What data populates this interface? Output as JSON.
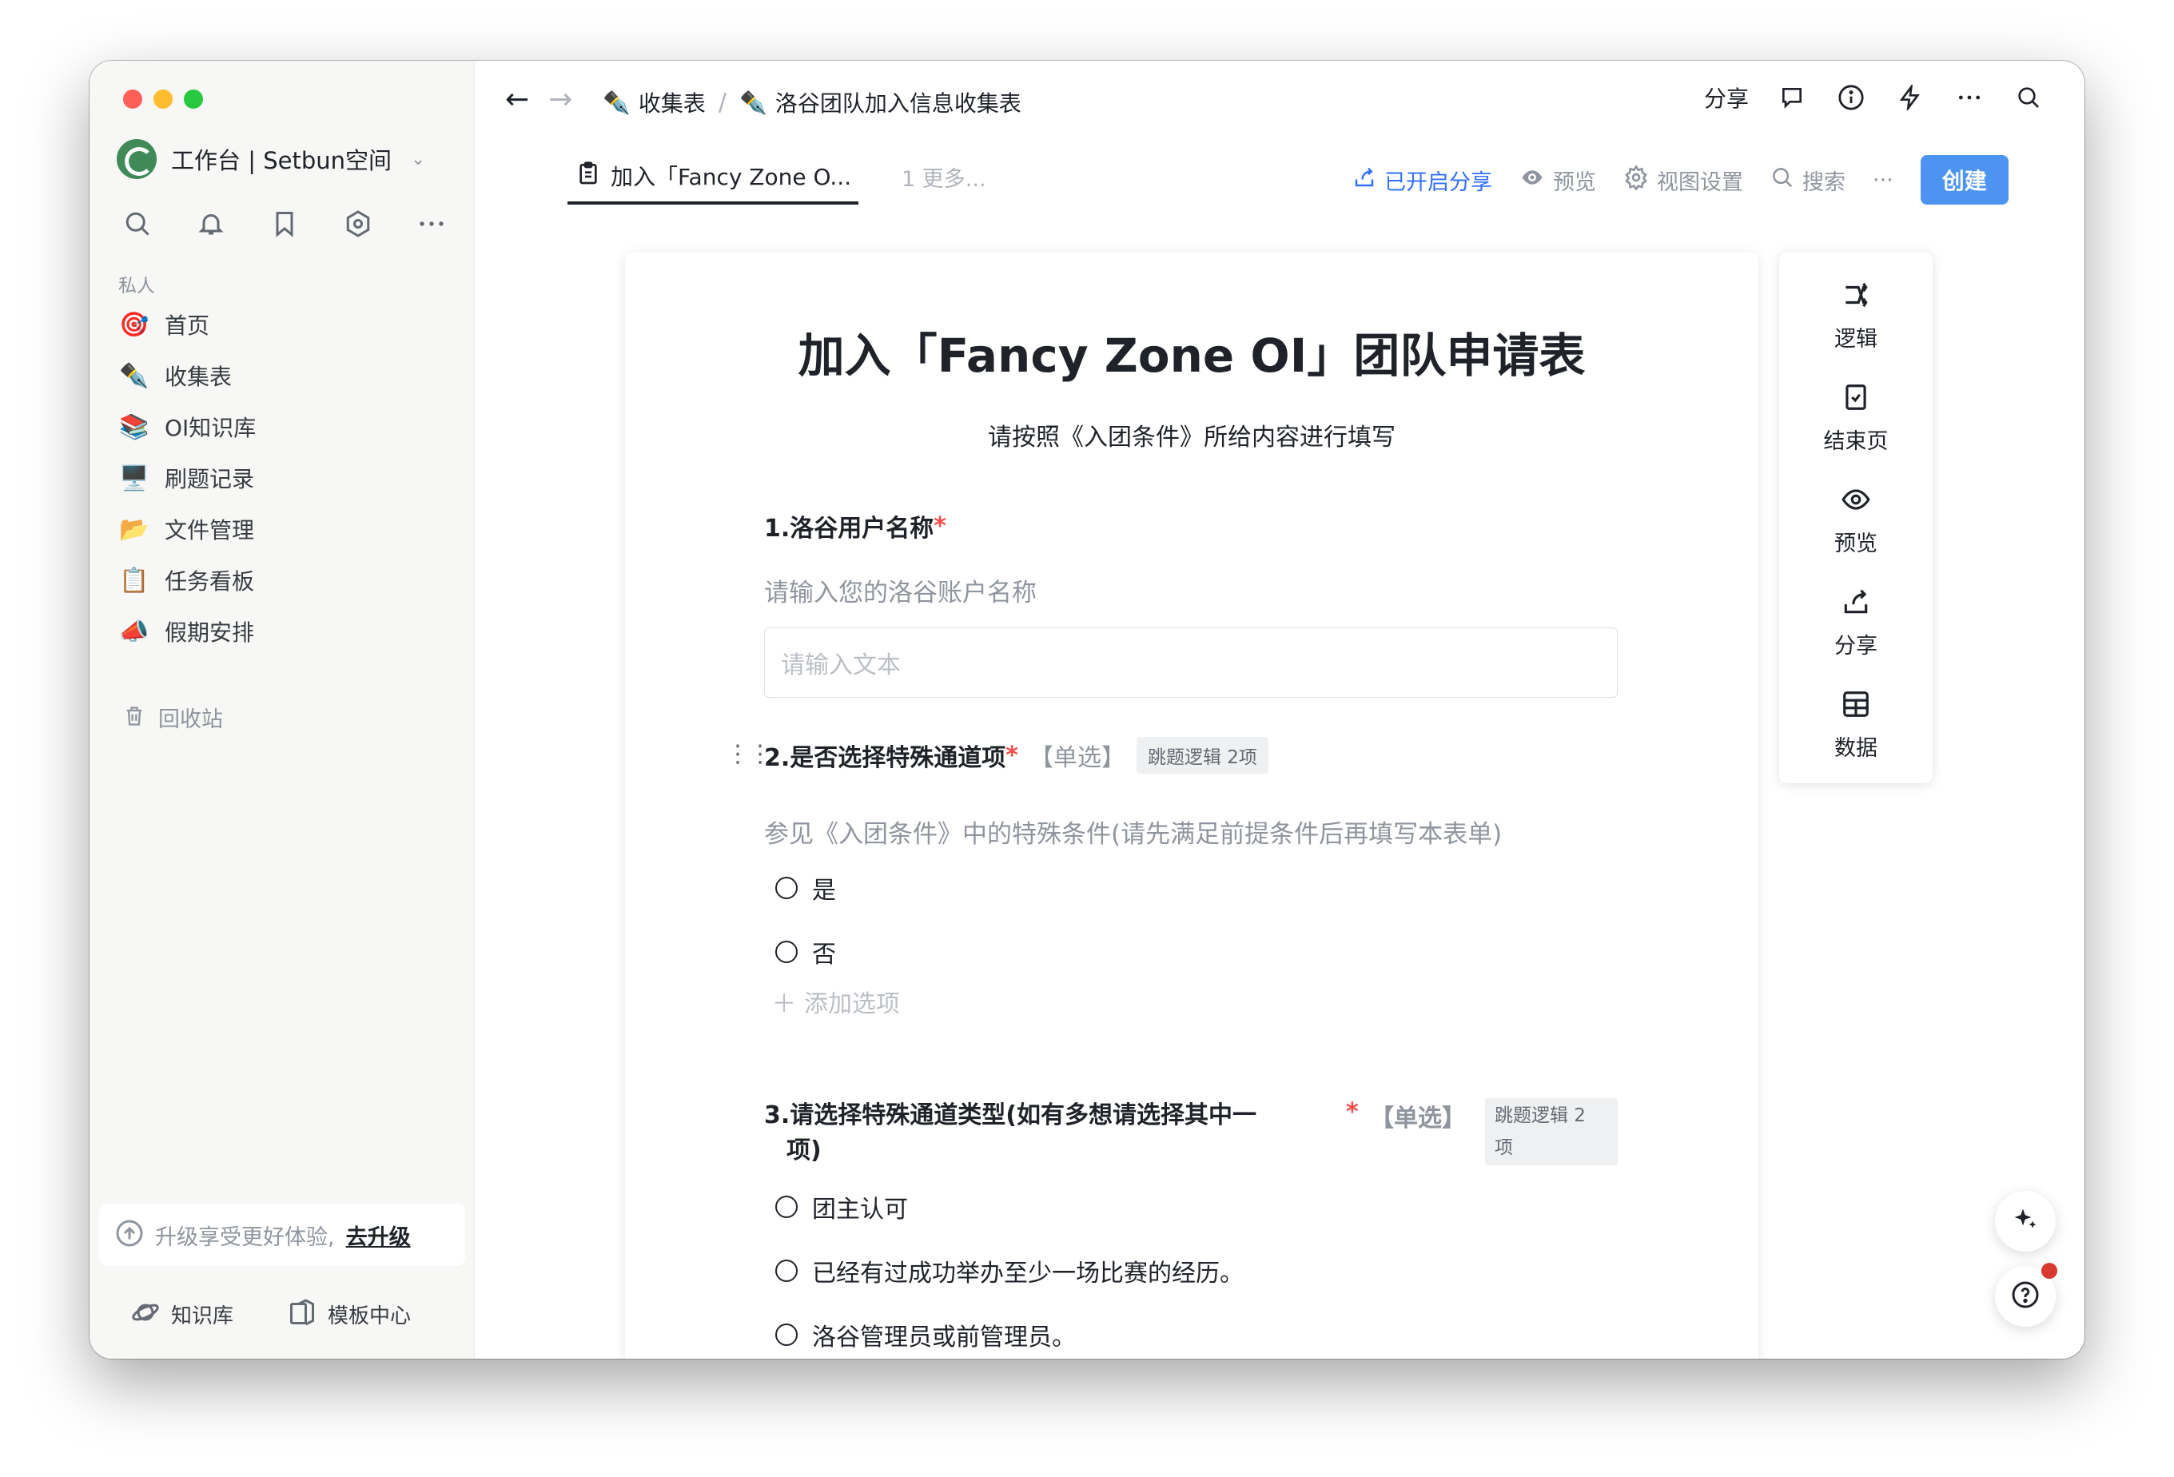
{
  "workspace": {
    "name": "工作台 | Setbun空间"
  },
  "sidebar": {
    "section_label": "私人",
    "items": [
      {
        "label": "首页",
        "icon": "🎯"
      },
      {
        "label": "收集表",
        "icon": "✒️"
      },
      {
        "label": "OI知识库",
        "icon": "📚"
      },
      {
        "label": "刷题记录",
        "icon": "🖥️"
      },
      {
        "label": "文件管理",
        "icon": "📂"
      },
      {
        "label": "任务看板",
        "icon": "📋"
      },
      {
        "label": "假期安排",
        "icon": "📣"
      }
    ],
    "trash_label": "回收站",
    "upgrade_text": "升级享受更好体验,",
    "upgrade_link": "去升级",
    "bottom_links": [
      {
        "label": "知识库",
        "icon": "planet-icon"
      },
      {
        "label": "模板中心",
        "icon": "template-icon"
      }
    ]
  },
  "topbar": {
    "breadcrumbs": [
      "收集表",
      "洛谷团队加入信息收集表"
    ],
    "share_label": "分享"
  },
  "tabs": {
    "active_label": "加入「Fancy Zone O...",
    "more_label": "1 更多...",
    "actions": {
      "shared": "已开启分享",
      "preview": "预览",
      "view_settings": "视图设置",
      "search": "搜索",
      "more": "···",
      "create": "创建"
    }
  },
  "form": {
    "title": "加入「Fancy Zone OI」团队申请表",
    "subtitle": "请按照《入团条件》所给内容进行填写",
    "questions": [
      {
        "title": "1.洛谷用户名称",
        "required": "*",
        "description": "请输入您的洛谷账户名称",
        "input_placeholder": "请输入文本"
      },
      {
        "title": "2.是否选择特殊通道项",
        "required": "*",
        "type": "【单选】",
        "logic_tag": "跳题逻辑 2项",
        "description": "参见《入团条件》中的特殊条件(请先满足前提条件后再填写本表单)",
        "options": [
          "是",
          "否"
        ],
        "add_option": "添加选项"
      },
      {
        "title_line1": "3.请选择特殊通道类型(如有多想请选择其中一",
        "title_line2": "项)",
        "required": "*",
        "type": "【单选】",
        "logic_tag_line1": "跳题逻辑 2",
        "logic_tag_line2": "项",
        "options": [
          "团主认可",
          "已经有过成功举办至少一场比赛的经历。",
          "洛谷管理员或前管理员。"
        ]
      }
    ]
  },
  "right_panel": [
    {
      "label": "逻辑",
      "icon": "logic-icon"
    },
    {
      "label": "结束页",
      "icon": "end-page-icon"
    },
    {
      "label": "预览",
      "icon": "eye-icon"
    },
    {
      "label": "分享",
      "icon": "share-icon"
    },
    {
      "label": "数据",
      "icon": "table-icon"
    }
  ],
  "colors": {
    "accent": "#3370ff",
    "create_button": "#4c94f0",
    "required": "#f54a45",
    "notification_dot": "#d83931"
  }
}
